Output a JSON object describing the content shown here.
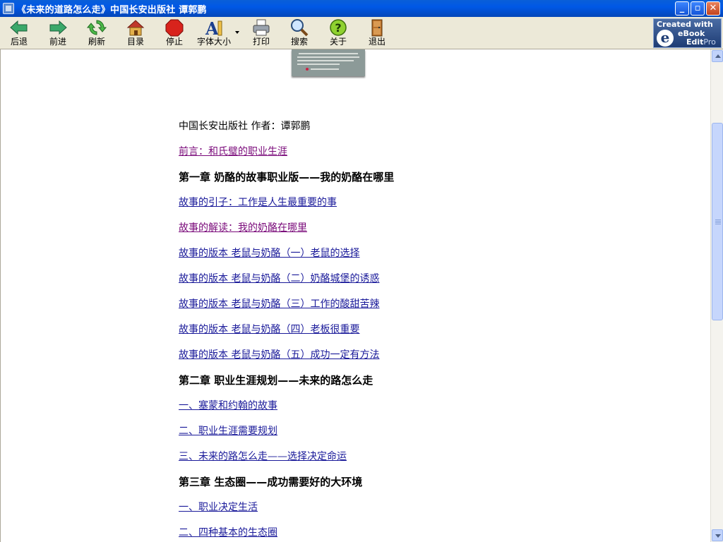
{
  "window": {
    "title": "《未来的道路怎么走》中国长安出版社  谭郭鹏"
  },
  "toolbar": {
    "buttons": [
      {
        "label": "后退",
        "icon": "back-arrow-icon"
      },
      {
        "label": "前进",
        "icon": "forward-arrow-icon"
      },
      {
        "label": "刷新",
        "icon": "refresh-icon"
      },
      {
        "label": "目录",
        "icon": "home-icon"
      },
      {
        "label": "停止",
        "icon": "stop-icon"
      },
      {
        "label": "字体大小",
        "icon": "font-size-icon"
      },
      {
        "label": "打印",
        "icon": "printer-icon"
      },
      {
        "label": "搜索",
        "icon": "magnifier-icon"
      },
      {
        "label": "关于",
        "icon": "help-icon"
      },
      {
        "label": "退出",
        "icon": "exit-door-icon"
      }
    ],
    "logo": {
      "line1": "Created with",
      "badge": "e",
      "line2": "eBook",
      "line3a": "Edit",
      "line3b": "Pro"
    }
  },
  "toc": [
    {
      "text": "中国长安出版社 作者：谭郭鹏",
      "style": "plain"
    },
    {
      "text": "前言：和氏璧的职业生涯",
      "style": "visited"
    },
    {
      "text": "第一章 奶酪的故事职业版——我的奶酪在哪里",
      "style": "chapter"
    },
    {
      "text": "故事的引子：工作是人生最重要的事 ",
      "style": "link"
    },
    {
      "text": "故事的解读：我的奶酪在哪里",
      "style": "visited"
    },
    {
      "text": "故事的版本 老鼠与奶酪（一）老鼠的选择 ",
      "style": "link"
    },
    {
      "text": "故事的版本 老鼠与奶酪（二）奶酪城堡的诱惑 ",
      "style": "link"
    },
    {
      "text": "故事的版本 老鼠与奶酪（三）工作的酸甜苦辣 ",
      "style": "link"
    },
    {
      "text": "故事的版本 老鼠与奶酪（四）老板很重要 ",
      "style": "link"
    },
    {
      "text": "故事的版本 老鼠与奶酪（五）成功一定有方法 ",
      "style": "link"
    },
    {
      "text": "第二章 职业生涯规划——未来的路怎么走",
      "style": "chapter"
    },
    {
      "text": "一、塞蒙和约翰的故事 ",
      "style": "link"
    },
    {
      "text": "二、职业生涯需要规划 ",
      "style": "link"
    },
    {
      "text": "三、未来的路怎么走——选择决定命运 ",
      "style": "link"
    },
    {
      "text": "第三章 生态圈——成功需要好的大环境",
      "style": "chapter"
    },
    {
      "text": "一、职业决定生活 ",
      "style": "link"
    },
    {
      "text": "二、四种基本的生态圈 ",
      "style": "link"
    }
  ]
}
